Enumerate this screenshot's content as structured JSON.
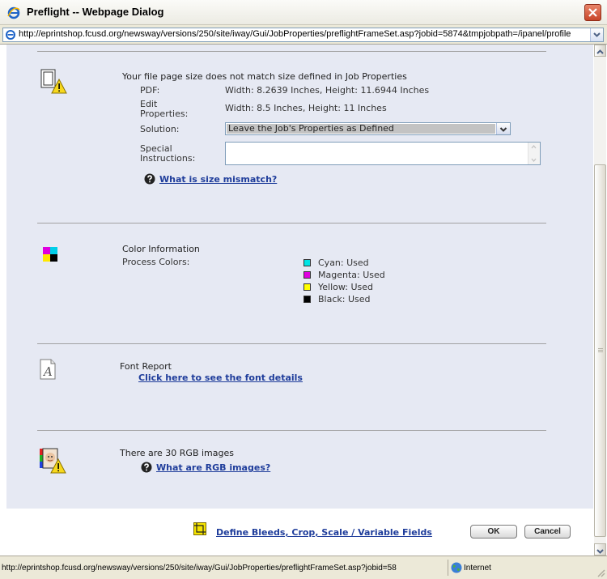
{
  "window": {
    "title": "Preflight -- Webpage Dialog",
    "address": "http://eprintshop.fcusd.org/newsway/versions/250/site/iway/Gui/JobProperties/preflightFrameSet.asp?jobid=5874&tmpjobpath=/ipanel/profile"
  },
  "size_section": {
    "heading": "Your file page size does not match size defined in Job Properties",
    "pdf_label": "PDF:",
    "pdf_value": "Width: 8.2639 Inches,  Height: 11.6944 Inches",
    "edit_label_1": "Edit",
    "edit_label_2": "Properties:",
    "edit_value": "Width: 8.5 Inches,  Height: 11 Inches",
    "solution_label": "Solution:",
    "solution_value": "Leave the Job's Properties as Defined",
    "special_label_1": "Special",
    "special_label_2": "Instructions:",
    "special_value": "",
    "help_link": "What is size mismatch?"
  },
  "color_section": {
    "heading": "Color Information",
    "process_label": "Process Colors:",
    "colors": [
      {
        "label": "Cyan: Used",
        "color": "#00e5e5"
      },
      {
        "label": "Magenta: Used",
        "color": "#e000e0"
      },
      {
        "label": "Yellow: Used",
        "color": "#ffff00"
      },
      {
        "label": "Black: Used",
        "color": "#000000"
      }
    ]
  },
  "font_section": {
    "heading": "Font Report",
    "link": "Click here to see the font details"
  },
  "rgb_section": {
    "heading": "There are 30 RGB images",
    "help_link": "What are RGB images?"
  },
  "footer": {
    "bleeds_link": "Define Bleeds, Crop, Scale / Variable Fields",
    "ok_label": "OK",
    "cancel_label": "Cancel"
  },
  "status": {
    "url": "http://eprintshop.fcusd.org/newsway/versions/250/site/iway/Gui/JobProperties/preflightFrameSet.asp?jobid=58",
    "zone": "Internet"
  },
  "icons": {
    "app": "ie-icon",
    "page_size_warning": "page-warning-icon",
    "color_info": "cmyk-icon",
    "font_report": "font-icon",
    "rgb_warning": "rgb-image-warning-icon",
    "help": "help-icon",
    "bleeds": "crop-icon",
    "zone": "globe-icon"
  }
}
